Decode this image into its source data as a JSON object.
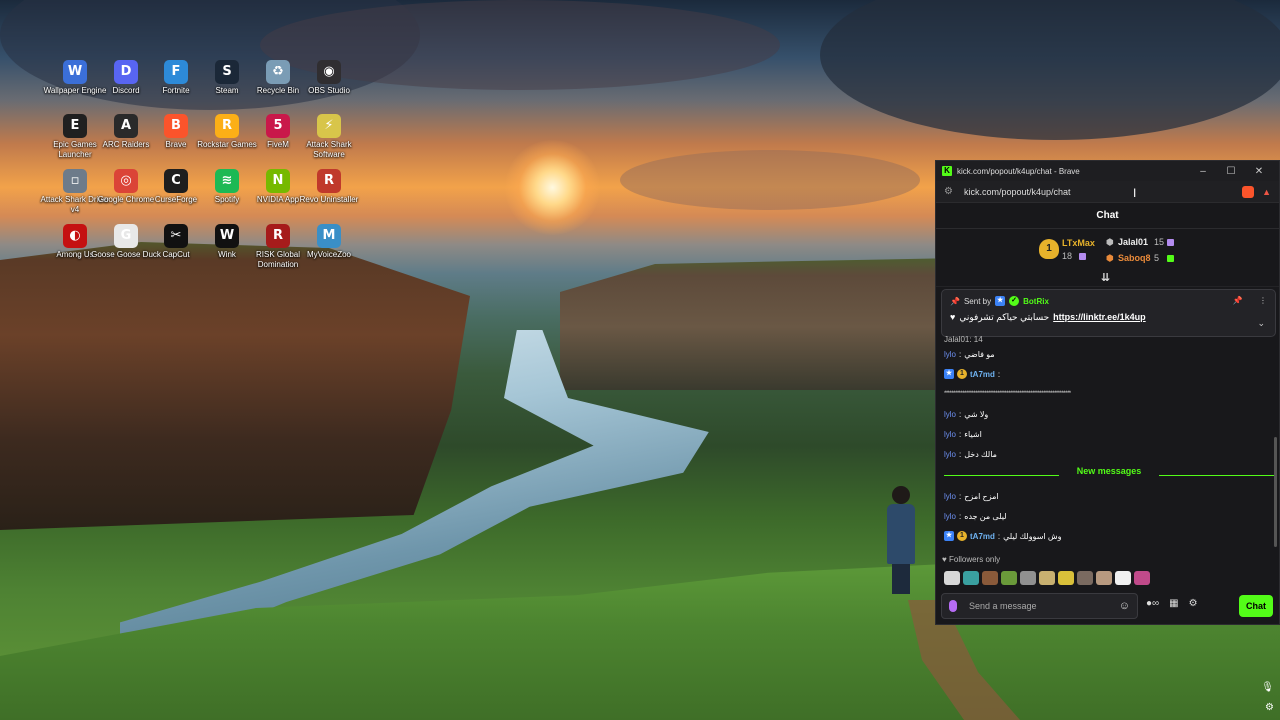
{
  "desktop": {
    "icons": [
      {
        "label": "Wallpaper Engine",
        "icon": "wallpaper-engine-icon",
        "color": "#3b6fd8",
        "glyph": "W"
      },
      {
        "label": "Discord",
        "icon": "discord-icon",
        "color": "#5865f2",
        "glyph": "D"
      },
      {
        "label": "Fortnite",
        "icon": "fortnite-icon",
        "color": "#2d8ad8",
        "glyph": "F"
      },
      {
        "label": "Steam",
        "icon": "steam-icon",
        "color": "#1b2838",
        "glyph": "S"
      },
      {
        "label": "Recycle Bin",
        "icon": "recycle-bin-icon",
        "color": "#7a9cb5",
        "glyph": "♻"
      },
      {
        "label": "OBS Studio",
        "icon": "obs-studio-icon",
        "color": "#302e31",
        "glyph": "◉"
      },
      {
        "label": "Epic Games Launcher",
        "icon": "epic-games-icon",
        "color": "#202020",
        "glyph": "E"
      },
      {
        "label": "ARC Raiders",
        "icon": "arc-raiders-icon",
        "color": "#2a2a2a",
        "glyph": "A"
      },
      {
        "label": "Brave",
        "icon": "brave-icon",
        "color": "#fb542b",
        "glyph": "B"
      },
      {
        "label": "Rockstar Games",
        "icon": "rockstar-icon",
        "color": "#fcaf17",
        "glyph": "R"
      },
      {
        "label": "FiveM",
        "icon": "fivem-icon",
        "color": "#c9184a",
        "glyph": "5"
      },
      {
        "label": "Attack Shark Software",
        "icon": "attack-shark-icon",
        "color": "#d8c54a",
        "glyph": "⚡"
      },
      {
        "label": "Attack Shark Driver v4",
        "icon": "attack-shark-driver-icon",
        "color": "#6d7b8a",
        "glyph": "▫"
      },
      {
        "label": "Google Chrome",
        "icon": "chrome-icon",
        "color": "#db4437",
        "glyph": "◎"
      },
      {
        "label": "CurseForge",
        "icon": "curseforge-icon",
        "color": "#1e1e1e",
        "glyph": "C"
      },
      {
        "label": "Spotify",
        "icon": "spotify-icon",
        "color": "#1db954",
        "glyph": "≋"
      },
      {
        "label": "NVIDIA App",
        "icon": "nvidia-icon",
        "color": "#76b900",
        "glyph": "N"
      },
      {
        "label": "Revo Uninstaller",
        "icon": "revo-uninstaller-icon",
        "color": "#c0392b",
        "glyph": "R"
      },
      {
        "label": "Among Us",
        "icon": "among-us-icon",
        "color": "#c51111",
        "glyph": "◐"
      },
      {
        "label": "Goose Goose Duck",
        "icon": "goose-goose-duck-icon",
        "color": "#e8e8e8",
        "glyph": "G"
      },
      {
        "label": "CapCut",
        "icon": "capcut-icon",
        "color": "#111111",
        "glyph": "✂"
      },
      {
        "label": "Wink",
        "icon": "wink-icon",
        "color": "#111111",
        "glyph": "W"
      },
      {
        "label": "RISK Global Domination",
        "icon": "risk-icon",
        "color": "#a61b1b",
        "glyph": "R"
      },
      {
        "label": "MyVoiceZoo",
        "icon": "myvoicezoo-icon",
        "color": "#3a8fc7",
        "glyph": "M"
      }
    ]
  },
  "browser": {
    "title": "kick.com/popout/k4up/chat - Brave",
    "url": "kick.com/popout/k4up/chat",
    "controls": {
      "minimize": "–",
      "maximize": "☐",
      "close": "✕"
    }
  },
  "chat": {
    "header": "Chat",
    "leaderboard": {
      "first": {
        "rank": "1",
        "name": "LTxMax",
        "count": "18"
      },
      "second": {
        "name": "Jalal01",
        "count": "15"
      },
      "third": {
        "name": "Saboq8",
        "count": "5"
      }
    },
    "pinned": {
      "sent_by": "Sent by",
      "bot": "BotRix",
      "text": "حسابتي حياكم تشرفوني",
      "link": "https://linktr.ee/1k4up"
    },
    "partial_top": "Jalal01: 14",
    "messages_before": [
      {
        "user": "lylo",
        "text": "مو فاضي",
        "badges": []
      },
      {
        "user": "tA7md",
        "text": "",
        "badges": [
          "blue",
          "gold"
        ]
      },
      {
        "user": "",
        "text": "*********************************************************************",
        "badges": [],
        "stars": true
      },
      {
        "user": "lylo",
        "text": "ولا شي",
        "badges": []
      },
      {
        "user": "lylo",
        "text": "اشياء",
        "badges": []
      },
      {
        "user": "lylo",
        "text": "مالك دخل",
        "badges": []
      }
    ],
    "new_messages_label": "New messages",
    "messages_after": [
      {
        "user": "lylo",
        "text": "امزح امزح",
        "badges": []
      },
      {
        "user": "lylo",
        "text": "ليلى من جده",
        "badges": []
      },
      {
        "user": "tA7md",
        "text": "وش اسوولك ليلي",
        "badges": [
          "blue",
          "gold"
        ]
      }
    ],
    "followers_only": "Followers only",
    "emote_colors": [
      "#d7d7d7",
      "#3aa0a0",
      "#8a5a3a",
      "#6a9a3a",
      "#909090",
      "#c8b070",
      "#d9c03a",
      "#7a6a60",
      "#b89a80",
      "#f0f0f0",
      "#c04a8a"
    ],
    "input_placeholder": "Send a message",
    "send_label": "Chat",
    "accent": "#53fc18"
  }
}
